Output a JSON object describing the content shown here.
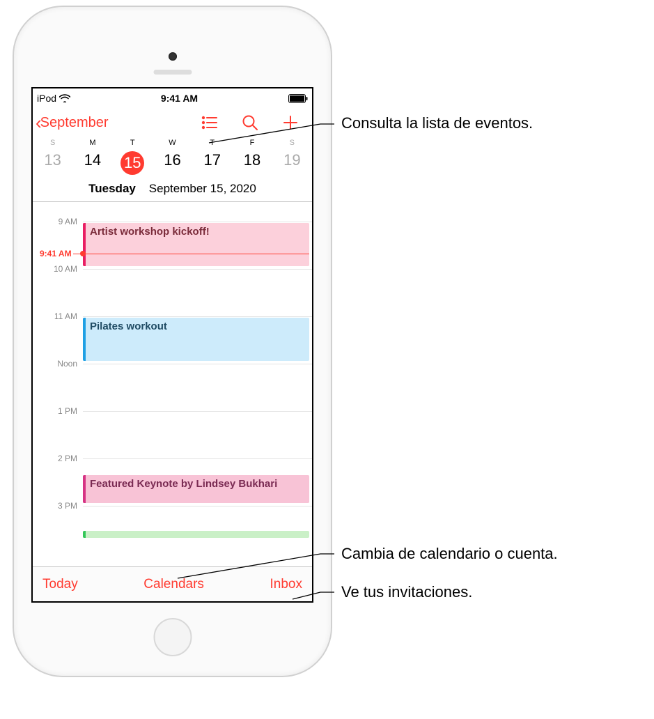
{
  "status": {
    "carrier": "iPod",
    "time": "9:41 AM"
  },
  "nav": {
    "back_label": "September"
  },
  "week": {
    "day_letters": [
      "S",
      "M",
      "T",
      "W",
      "T",
      "F",
      "S"
    ],
    "dates": [
      "13",
      "14",
      "15",
      "16",
      "17",
      "18",
      "19"
    ],
    "selected_index": 2,
    "full_date_prefix": "Tuesday",
    "full_date_rest": "September 15, 2020"
  },
  "timeline": {
    "labels": {
      "h9": "9 AM",
      "h10": "10 AM",
      "h11": "11 AM",
      "h12": "Noon",
      "h13": "1 PM",
      "h14": "2 PM",
      "h15": "3 PM"
    },
    "now_label": "9:41 AM"
  },
  "events": {
    "e1": "Artist workshop kickoff!",
    "e2": "Pilates workout",
    "e3": "Featured Keynote by Lindsey Bukhari"
  },
  "toolbar": {
    "today": "Today",
    "calendars": "Calendars",
    "inbox": "Inbox"
  },
  "callouts": {
    "c1": "Consulta la lista de eventos.",
    "c2": "Cambia de calendario o cuenta.",
    "c3": "Ve tus invitaciones."
  }
}
